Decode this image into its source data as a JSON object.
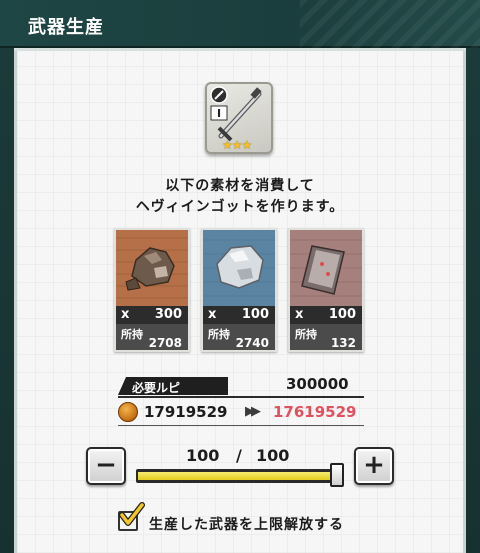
{
  "header": {
    "title": "武器生産"
  },
  "weapon": {
    "stars": "★★★",
    "rarity": 3
  },
  "description": {
    "line1": "以下の素材を消費して",
    "line2": "ヘヴィインゴットを作ります。"
  },
  "materials": [
    {
      "qty_prefix": "x",
      "qty": "300",
      "owned_label": "所持",
      "owned": "2708",
      "color": "#b8714a"
    },
    {
      "qty_prefix": "x",
      "qty": "100",
      "owned_label": "所持",
      "owned": "2740",
      "color": "#5e86a4"
    },
    {
      "qty_prefix": "x",
      "qty": "100",
      "owned_label": "所持",
      "owned": "132",
      "color": "#a77a75"
    }
  ],
  "rupee": {
    "required_label": "必要ルピ",
    "required": "300000",
    "current": "17919529",
    "arrow": "▶▶",
    "after": "17619529"
  },
  "stepper": {
    "minus": "−",
    "plus": "+",
    "current": "100",
    "separator": "/",
    "max": "100",
    "fill_fraction": 1.0
  },
  "option": {
    "checked": true,
    "label": "生産した武器を上限解放する"
  },
  "colors": {
    "header_bg": "#1e4644",
    "accent_red": "#e0505e",
    "slider_yellow": "#e8d42a",
    "star_gold": "#f3bf28"
  }
}
